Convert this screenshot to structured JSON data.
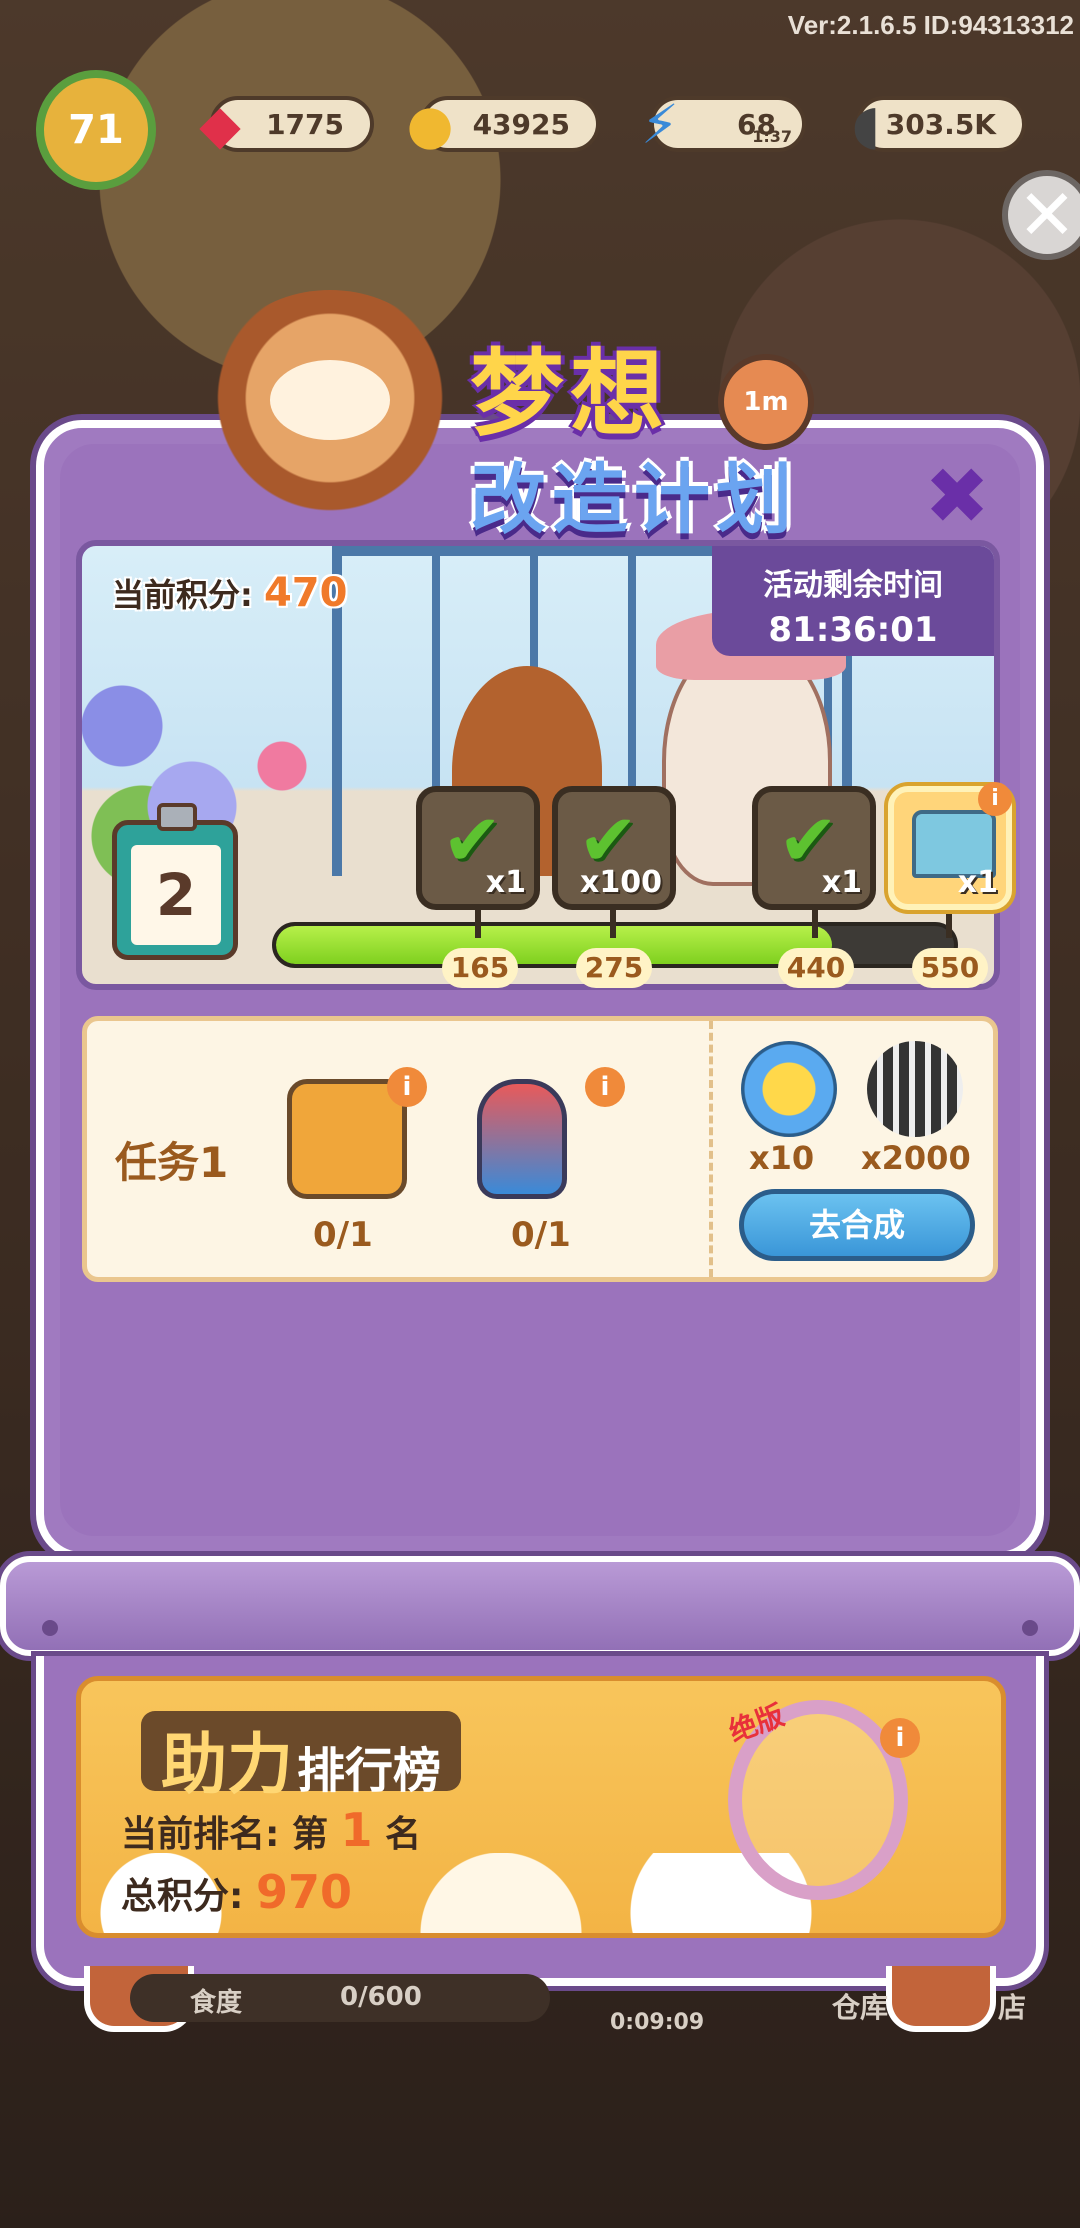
{
  "header": {
    "version": "Ver:2.1.6.5 ID:94313312",
    "level": "71",
    "resources": [
      {
        "icon": "gem-icon",
        "value": "1775"
      },
      {
        "icon": "coin-icon",
        "value": "43925"
      },
      {
        "icon": "energy-icon",
        "value": "68",
        "timer": "1:37"
      },
      {
        "icon": "sunflower-seed-icon",
        "value": "303.5K"
      }
    ]
  },
  "event": {
    "title_line1": "梦想",
    "title_line2": "改造计划",
    "current_score_label": "当前积分:",
    "current_score": "470",
    "time_left_label": "活动剩余时间",
    "time_left": "81:36:01",
    "stage_number": "2",
    "progress": 0.82,
    "milestones": [
      {
        "threshold": "165",
        "count": "x1",
        "claimed": true
      },
      {
        "threshold": "275",
        "count": "x100",
        "claimed": true
      },
      {
        "threshold": "440",
        "count": "x1",
        "claimed": true
      },
      {
        "threshold": "550",
        "count": "x1",
        "claimed": false
      }
    ]
  },
  "task": {
    "title": "任务1",
    "items": [
      {
        "icon": "film-projector-icon",
        "progress": "0/1"
      },
      {
        "icon": "spray-bottle-icon",
        "progress": "0/1"
      }
    ],
    "rewards": [
      {
        "icon": "blue-flower-icon",
        "amount": "x10"
      },
      {
        "icon": "sunflower-seed-icon",
        "amount": "x2000"
      }
    ],
    "go_button": "去合成"
  },
  "ranking": {
    "title_big": "助力",
    "title_small": "排行榜",
    "current_rank_label": "当前排名:",
    "rank_prefix": "第",
    "rank_value": "1",
    "rank_suffix": "名",
    "total_score_label": "总积分:",
    "total_score": "970",
    "badge": "绝版"
  },
  "bottom": {
    "food_label": "食度",
    "food_value": "0/600",
    "timer": "0:09:09",
    "warehouse": "仓库",
    "shop": "店"
  },
  "colors": {
    "panel": "#9b73bc",
    "accent_orange": "#f07a2a",
    "button_blue": "#3a96d8",
    "progress_green": "#7fd01f"
  }
}
